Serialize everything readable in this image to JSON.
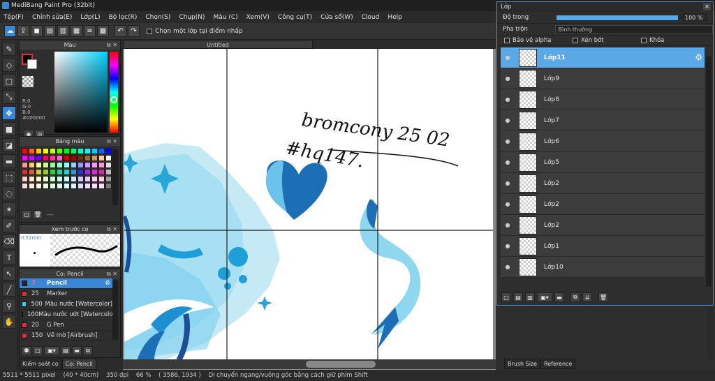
{
  "app": {
    "title": "MediBang Paint Pro (32bit)"
  },
  "menu": [
    "Tệp(F)",
    "Chỉnh sửa(E)",
    "Lớp(L)",
    "Bộ lọc(R)",
    "Chọn(S)",
    "Chụp(N)",
    "Màu (C)",
    "Xem(V)",
    "Công cụ(T)",
    "Cửa sổ(W)",
    "Cloud",
    "Help"
  ],
  "toolbar": {
    "select_layer_label": "Chọn một lớp tại điểm nhấp"
  },
  "color_panel": {
    "title": "Màu",
    "r": "R:0",
    "g": "G:0",
    "b": "B:0",
    "hex": "#000000"
  },
  "palette_panel": {
    "title": "Bảng màu",
    "footer": "---",
    "swatches": [
      "#ff0000",
      "#ff6600",
      "#ffcc00",
      "#ffff00",
      "#ccff00",
      "#66ff00",
      "#00ff00",
      "#00ff66",
      "#00ffcc",
      "#00ffff",
      "#00ccff",
      "#0066ff",
      "#0000ff",
      "#ff00ff",
      "#cc00ff",
      "#6600ff",
      "#ff0066",
      "#ff3399",
      "#ff66cc",
      "#cc0000",
      "#990000",
      "#663300",
      "#996633",
      "#cc9966",
      "#ffcc99",
      "#ffffff",
      "#ff9999",
      "#ffcc66",
      "#ffff99",
      "#ccff99",
      "#99ff99",
      "#99ffcc",
      "#99ffff",
      "#99ccff",
      "#9999ff",
      "#cc99ff",
      "#ff99ff",
      "#ff99cc",
      "#e0e0e0",
      "#cc3333",
      "#cc6633",
      "#cccc33",
      "#99cc33",
      "#33cc33",
      "#33cc99",
      "#33cccc",
      "#3399cc",
      "#3333cc",
      "#9933cc",
      "#cc33cc",
      "#cc3399",
      "#bdbdbd",
      "#ffcccc",
      "#ffe5cc",
      "#ffffcc",
      "#e5ffcc",
      "#ccffcc",
      "#ccffe5",
      "#ccffff",
      "#cce5ff",
      "#ccccff",
      "#e5ccff",
      "#ffccff",
      "#ffcce5",
      "#9e9e9e",
      "#ffdddd",
      "#ffeedd",
      "#ffffdd",
      "#eeffdd",
      "#ddffdd",
      "#ddffee",
      "#ddffff",
      "#ddeeff",
      "#ddddff",
      "#eeddff",
      "#ffddff",
      "#ffddee",
      "#7a7a7a"
    ]
  },
  "preview_panel": {
    "title": "Xem trước cọ",
    "size": "0.51mm"
  },
  "brush_panel": {
    "title": "Cọ: Pencil",
    "items": [
      {
        "size": "7",
        "name": "Pencil",
        "color": "#1a2a3a"
      },
      {
        "size": "25",
        "name": "Marker",
        "color": "#e03030"
      },
      {
        "size": "500",
        "name": "Màu nước [Watercolor]",
        "color": "#40c8f0"
      },
      {
        "size": "100",
        "name": "Màu nước ướt [Watercolor Wet]",
        "color": "#40c8f0"
      },
      {
        "size": "20",
        "name": "G Pen",
        "color": "#e03030"
      },
      {
        "size": "150",
        "name": "Vẽ mờ [Airbrush]",
        "color": "#e03030"
      }
    ]
  },
  "bottom_tabs": [
    "Kiểm soát cọ",
    "Cọ: Pencil"
  ],
  "document": {
    "tab_title": "Untitled"
  },
  "canvas": {
    "handwriting_1": "bromcony 25 02",
    "handwriting_2": "#hq147."
  },
  "layer_panel": {
    "title": "Lớp",
    "opacity_label": "Độ trong",
    "opacity_value": "100 %",
    "opacity_fraction": 1.0,
    "blend_label": "Pha trộn",
    "blend_value": "Bình thường",
    "opt_protect": "Bảo vệ alpha",
    "opt_clip": "Xén bớt",
    "opt_lock": "Khóa",
    "layers": [
      "Lớp11",
      "Lớp9",
      "Lớp8",
      "Lớp7",
      "Lớp6",
      "Lớp5",
      "Lớp2",
      "Lớp2",
      "Lớp2",
      "Lớp1",
      "Lớp10"
    ]
  },
  "right_tabs": [
    "Brush Size",
    "Reference"
  ],
  "status": {
    "size": "5511 * 5511 pixel",
    "cm": "(40 * 40cm)",
    "dpi": "350 dpi",
    "zoom": "66 %",
    "coords": "( 3586, 1934 )",
    "hint": "Di chuyển ngang/vuông góc bằng cách giữ phím Shift"
  }
}
